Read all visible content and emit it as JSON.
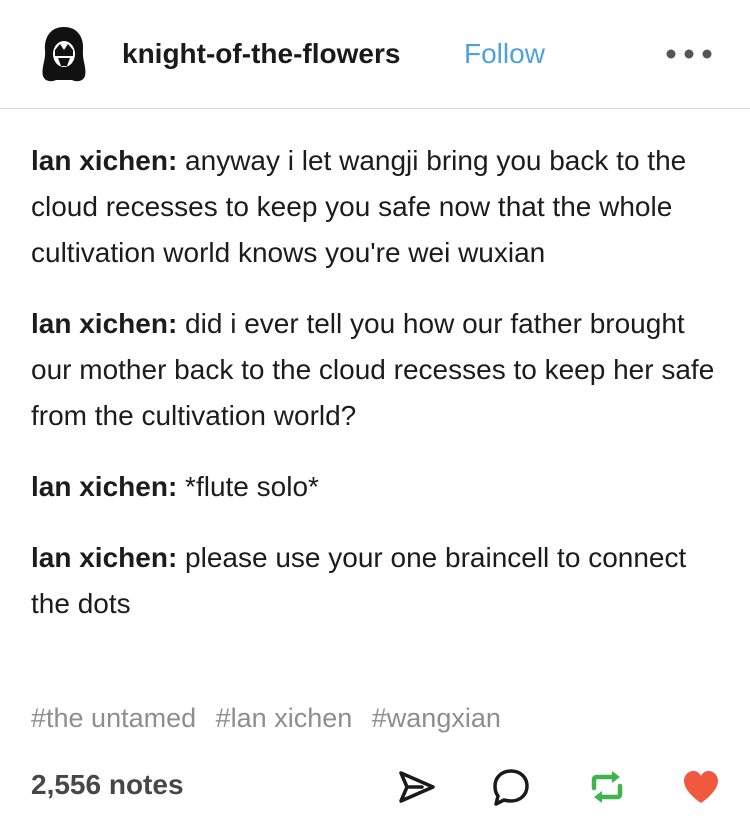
{
  "header": {
    "username": "knight-of-the-flowers",
    "follow_label": "Follow",
    "avatar_icon": "avatar-icon",
    "more_icon": "more-options-icon"
  },
  "post": {
    "lines": [
      {
        "speaker": "lan xichen:",
        "text": " anyway i let wangji bring you back to the cloud recesses to keep you safe now that the whole cultivation world knows you're wei wuxian"
      },
      {
        "speaker": "lan xichen:",
        "text": " did i ever tell you how our father brought our mother back to the cloud recesses to keep her safe from the cultivation world?"
      },
      {
        "speaker": "lan xichen:",
        "text": " *flute solo*"
      },
      {
        "speaker": "lan xichen:",
        "text": " please use your one braincell to connect the dots"
      }
    ]
  },
  "tags": [
    "#the untamed",
    "#lan xichen",
    "#wangxian"
  ],
  "footer": {
    "notes": "2,556 notes",
    "share_icon": "share-icon",
    "reply_icon": "reply-icon",
    "reblog_icon": "reblog-icon",
    "like_icon": "heart-icon"
  },
  "colors": {
    "follow": "#4ea2dc",
    "reblog": "#3fb44a",
    "like": "#f0593e",
    "tag": "#8e8e8e"
  }
}
